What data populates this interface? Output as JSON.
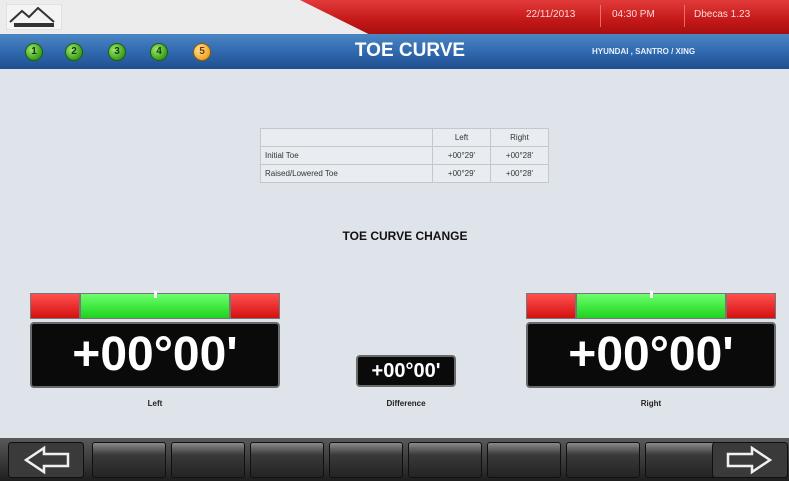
{
  "header": {
    "date": "22/11/2013",
    "time": "04:30 PM",
    "version": "Dbecas 1.23",
    "logo_icon": "mountain-logo"
  },
  "stepbar": {
    "steps": [
      "1",
      "2",
      "3",
      "4",
      "5"
    ],
    "current_step": "5",
    "title": "TOE CURVE",
    "vehicle": "HYUNDAI , SANTRO / XING"
  },
  "toe_table": {
    "headers": [
      "",
      "Left",
      "Right"
    ],
    "rows": [
      {
        "label": "Initial Toe",
        "left": "+00°29'",
        "right": "+00°28'"
      },
      {
        "label": "Raised/Lowered Toe",
        "left": "+00°29'",
        "right": "+00°28'"
      }
    ]
  },
  "change_section": {
    "title": "TOE CURVE CHANGE",
    "left_value": "+00°00'",
    "difference_value": "+00°00'",
    "right_value": "+00°00'",
    "left_label": "Left",
    "difference_label": "Difference",
    "right_label": "Right",
    "left_gauge_position": 0.5,
    "right_gauge_position": 0.5
  },
  "footer": {
    "prev_icon": "arrow-left-icon",
    "next_icon": "arrow-right-icon",
    "function_keys": 8
  },
  "colors": {
    "header_red": "#c41818",
    "stepbar_blue": "#2e67ad",
    "step_done": "#3b9e1a",
    "step_current": "#f0a428",
    "gauge_green": "#1dd31d",
    "gauge_red": "#d41010",
    "background": "#dfe3ea"
  }
}
